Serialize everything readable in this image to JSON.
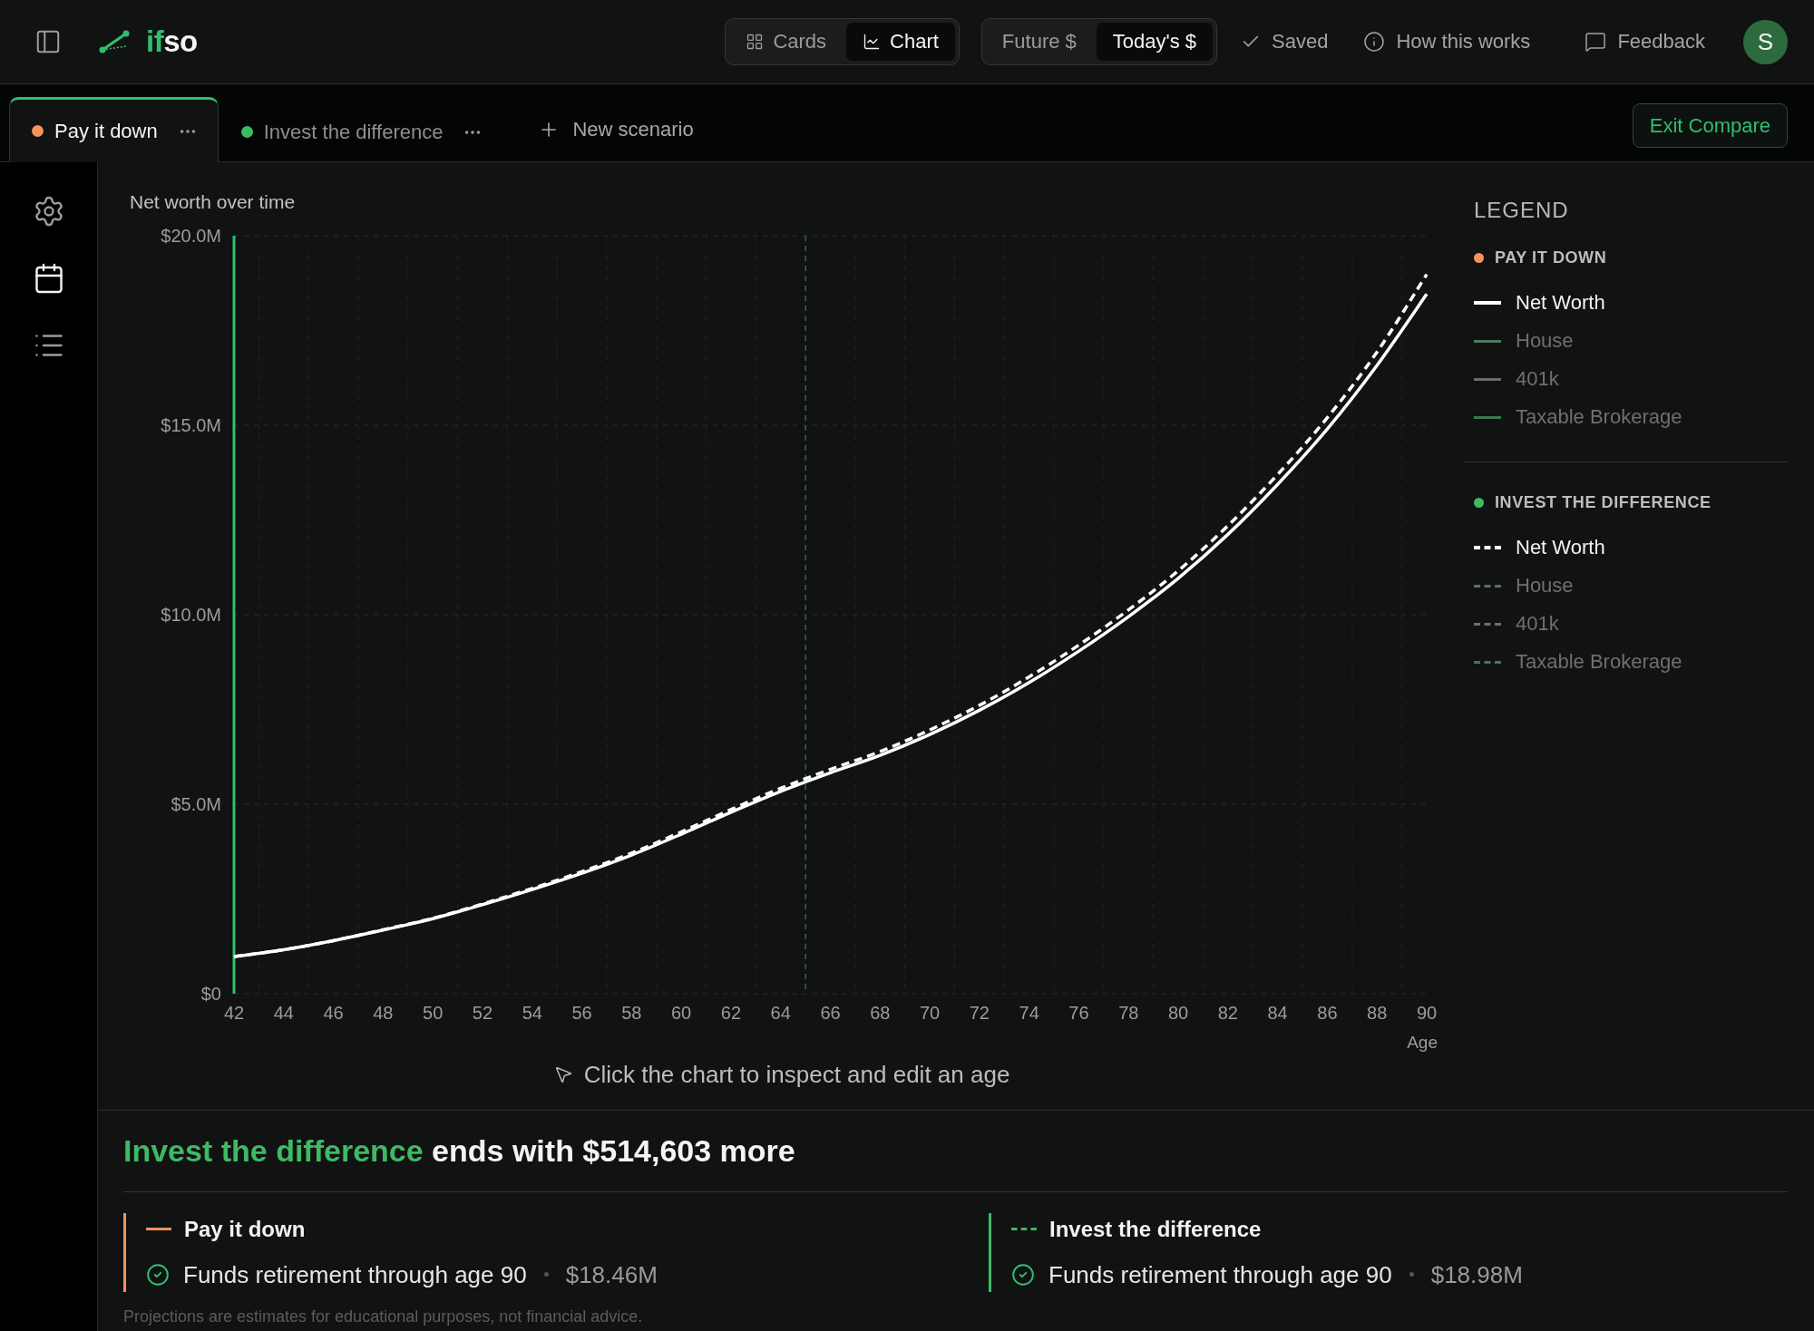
{
  "header": {
    "logo": {
      "accent": "if",
      "text": "so"
    },
    "view_modes": [
      {
        "label": "Cards",
        "kind": "grid",
        "selected": false
      },
      {
        "label": "Chart",
        "kind": "chart",
        "selected": true
      }
    ],
    "dollar_modes": [
      {
        "label": "Future $",
        "selected": false
      },
      {
        "label": "Today's $",
        "selected": true
      }
    ],
    "save_status": "Saved",
    "help_link": "How this works",
    "feedback_button": "Feedback",
    "avatar": "S"
  },
  "scenario_tabs": [
    {
      "label": "Pay it down",
      "color": "#f4935a",
      "selected": true
    },
    {
      "label": "Invest the difference",
      "color": "#3dba63",
      "selected": false
    }
  ],
  "new_scenario_button": "New scenario",
  "exit_compare_button": "Exit Compare",
  "sidebar": {
    "items": [
      {
        "kind": "settings",
        "selected": false
      },
      {
        "kind": "calendar",
        "selected": true
      },
      {
        "kind": "list",
        "selected": false
      }
    ]
  },
  "chart": {
    "chart_data": {
      "type": "line",
      "title": "Net worth over time",
      "xlabel": "Age",
      "x": [
        42,
        44,
        46,
        48,
        50,
        52,
        54,
        56,
        58,
        60,
        62,
        64,
        66,
        68,
        70,
        72,
        74,
        76,
        78,
        80,
        82,
        84,
        86,
        88,
        90
      ],
      "series": [
        {
          "name": "PAY IT DOWN",
          "color": "#ffffff",
          "line_style": "solid",
          "values": [
            0.98,
            1.16,
            1.4,
            1.68,
            1.98,
            2.35,
            2.75,
            3.18,
            3.66,
            4.21,
            4.79,
            5.34,
            5.83,
            6.29,
            6.84,
            7.48,
            8.21,
            9.04,
            9.95,
            10.96,
            12.12,
            13.44,
            14.9,
            16.58,
            18.46
          ]
        },
        {
          "name": "INVEST THE DIFFERENCE",
          "color": "#ffffff",
          "line_style": "dashed",
          "values": [
            0.98,
            1.16,
            1.4,
            1.69,
            1.99,
            2.37,
            2.78,
            3.22,
            3.71,
            4.27,
            4.86,
            5.42,
            5.92,
            6.39,
            6.96,
            7.61,
            8.36,
            9.2,
            10.13,
            11.16,
            12.35,
            13.7,
            15.2,
            16.93,
            18.98
          ]
        }
      ],
      "xlim": [
        42,
        90
      ],
      "ylim": [
        0,
        20
      ],
      "xticks": [
        42,
        44,
        46,
        48,
        50,
        52,
        54,
        56,
        58,
        60,
        62,
        64,
        66,
        68,
        70,
        72,
        74,
        76,
        78,
        80,
        82,
        84,
        86,
        88,
        90
      ],
      "yticks": [
        {
          "value": 0,
          "label": "$0"
        },
        {
          "value": 5,
          "label": "$5.0M"
        },
        {
          "value": 10,
          "label": "$10.0M"
        },
        {
          "value": 15,
          "label": "$15.0M"
        },
        {
          "value": 20,
          "label": "$20.0M"
        }
      ],
      "grid": true,
      "ref_lines": [
        {
          "axis": "x",
          "value": 65,
          "color": "#2e6443",
          "line_style": "dashed"
        }
      ]
    },
    "hint": "Click the chart to inspect and edit an age"
  },
  "legend": {
    "title": "LEGEND",
    "groups": [
      {
        "color": "#f4935a",
        "dashed": false,
        "items": [
          {
            "label": "Net Worth",
            "color": "#ffffff",
            "active": true
          },
          {
            "label": "House",
            "color": "#4f7a5d",
            "active": false
          },
          {
            "label": "401k",
            "color": "#6d6d6d",
            "active": false
          },
          {
            "label": "Taxable Brokerage",
            "color": "#3c7a4d",
            "active": false
          }
        ]
      },
      {
        "color": "#3dba63",
        "dashed": true,
        "items": [
          {
            "label": "Net Worth",
            "color": "#ffffff",
            "active": true
          },
          {
            "label": "House",
            "color": "#4f7a5d",
            "active": false
          },
          {
            "label": "401k",
            "color": "#6d6d6d",
            "active": false
          },
          {
            "label": "Taxable Brokerage",
            "color": "#3c7a4d",
            "active": false
          }
        ]
      }
    ]
  },
  "summary": {
    "winner": "Invest the difference",
    "headline": "ends with $514,603 more",
    "cards": [
      {
        "name": "Pay it down",
        "color": "#f4935a",
        "dashed": false,
        "funded": true,
        "status": "Funds retirement through age 90",
        "value": "$18.46M"
      },
      {
        "name": "Invest the difference",
        "color": "#3dba63",
        "dashed": true,
        "funded": true,
        "status": "Funds retirement through age 90",
        "value": "$18.98M"
      }
    ],
    "disclaimer": "Projections are estimates for educational purposes, not financial advice."
  }
}
